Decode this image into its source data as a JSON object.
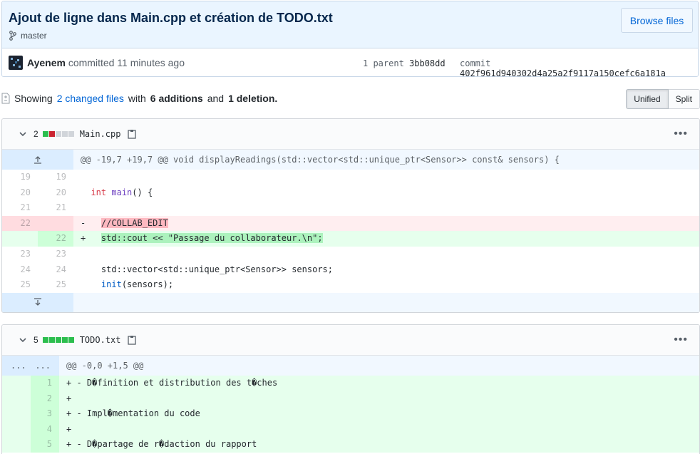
{
  "commit": {
    "title": "Ajout de ligne dans Main.cpp et création de TODO.txt",
    "branch": "master",
    "browse_label": "Browse files",
    "author": "Ayenem",
    "committed_text": "committed 11 minutes ago",
    "parent_label": "1 parent",
    "parent_sha": "3bb08dd",
    "commit_label": "commit",
    "commit_sha": "402f961d940302d4a25a2f9117a150cefc6a181a"
  },
  "toc": {
    "showing": "Showing",
    "changed_files": "2 changed files",
    "with": "with",
    "additions": "6 additions",
    "and": "and",
    "deletions": "1 deletion.",
    "unified_label": "Unified",
    "split_label": "Split"
  },
  "files": [
    {
      "count": "2",
      "name": "Main.cpp",
      "hunk_header": "@@ -19,7 +19,7 @@ void displayReadings(std::vector<std::unique_ptr<Sensor>> const& sensors) {",
      "lines": [
        {
          "type": "ctx",
          "old": "19",
          "new": "19"
        },
        {
          "type": "ctx",
          "old": "20",
          "new": "20"
        },
        {
          "type": "ctx",
          "old": "21",
          "new": "21"
        },
        {
          "type": "del",
          "old": "22",
          "new": ""
        },
        {
          "type": "add",
          "old": "",
          "new": "22"
        },
        {
          "type": "ctx",
          "old": "23",
          "new": "23"
        },
        {
          "type": "ctx",
          "old": "24",
          "new": "24"
        },
        {
          "type": "ctx",
          "old": "25",
          "new": "25"
        }
      ],
      "code": {
        "l20_kw": "int",
        "l20_fn": "main",
        "l20_rest": "() {",
        "l22_prefix": "-   ",
        "l22_text": "//COLLAB_EDIT",
        "l22b_prefix": "+   ",
        "l22b_text": "std::cout << \"Passage du collaborateur.\\n\";",
        "l24": "    std::vector<std::unique_ptr<Sensor>> sensors;",
        "l25_fn": "init",
        "l25_rest": "(sensors);"
      }
    },
    {
      "count": "5",
      "name": "TODO.txt",
      "hunk_header": "@@ -0,0 +1,5 @@",
      "expand_left": "...",
      "expand_right": "...",
      "lines": [
        {
          "new": "1",
          "text": "+ - D�finition et distribution des t�ches"
        },
        {
          "new": "2",
          "text": "+"
        },
        {
          "new": "3",
          "text": "+ - Impl�mentation du code"
        },
        {
          "new": "4",
          "text": "+"
        },
        {
          "new": "5",
          "text": "+ - D�partage de r�daction du rapport"
        }
      ]
    }
  ]
}
